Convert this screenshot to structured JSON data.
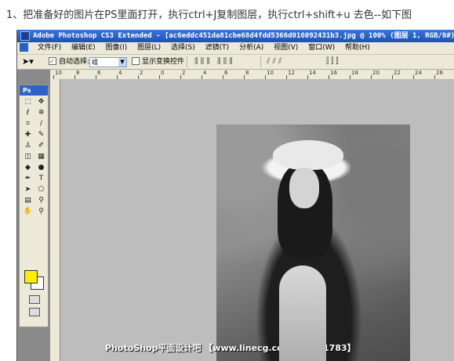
{
  "caption": "1、把准备好的图片在PS里面打开，执行ctrl+J复制图层，执行ctrl+shift+u 去色--如下图",
  "titlebar": {
    "text": "Adobe Photoshop CS3 Extended - [ac6eddc451da81cbe68d4fdd5366d016092431b3.jpg @ 100% (图层 1, RGB/8#)]"
  },
  "menubar": {
    "items": [
      "文件(F)",
      "编辑(E)",
      "图像(I)",
      "图层(L)",
      "选择(S)",
      "滤镜(T)",
      "分析(A)",
      "视图(V)",
      "窗口(W)",
      "帮助(H)"
    ]
  },
  "options": {
    "tool_icon": "move-tool-icon",
    "auto_select_label": "自动选择:",
    "auto_select_value": "组",
    "show_transform_label": "显示变换控件",
    "align_icons_1": "⫼⫼⫼ ⫼⫼⫼",
    "align_icons_2": "⫽⫽⫽",
    "align_icons_3": "⫿⫿⫿"
  },
  "toolbox": {
    "header": "Ps",
    "fg_color": "#ffee00",
    "bg_color": "#ffffff"
  },
  "ruler": {
    "ticks": [
      "10",
      "8",
      "6",
      "4",
      "2",
      "0",
      "2",
      "4",
      "6",
      "8",
      "10",
      "12",
      "14",
      "16",
      "18",
      "20",
      "22",
      "24",
      "26"
    ]
  },
  "watermark": "PhotoShop平面设计吧 【www.linecg.com/tieba/1783】"
}
